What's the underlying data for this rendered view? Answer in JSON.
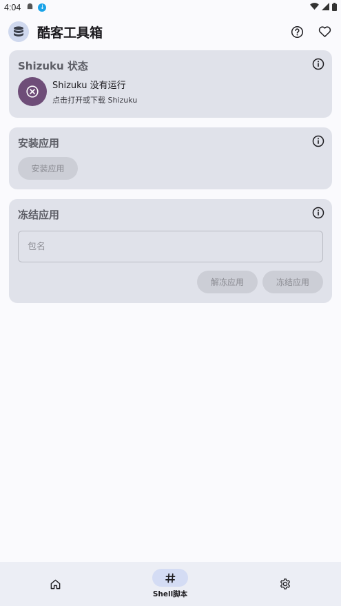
{
  "status_bar": {
    "time": "4:04"
  },
  "app": {
    "title": "酷客工具箱"
  },
  "shizuku_card": {
    "title": "Shizuku 状态",
    "status": "Shizuku 没有运行",
    "hint": "点击打开或下载 Shizuku"
  },
  "install_card": {
    "title": "安装应用",
    "button_label": "安装应用"
  },
  "freeze_card": {
    "title": "冻结应用",
    "package_placeholder": "包名",
    "package_value": "",
    "unfreeze_label": "解冻应用",
    "freeze_label": "冻结应用"
  },
  "bottom_nav": {
    "items": [
      {
        "icon": "home-icon",
        "label": ""
      },
      {
        "icon": "hash-icon",
        "label": "Shell脚本",
        "selected": true
      },
      {
        "icon": "gear-icon",
        "label": ""
      }
    ]
  },
  "colors": {
    "card_bg": "#e0e2ea",
    "shizuku_badge": "#6e4d78",
    "nav_indicator": "#d4dcf4"
  }
}
